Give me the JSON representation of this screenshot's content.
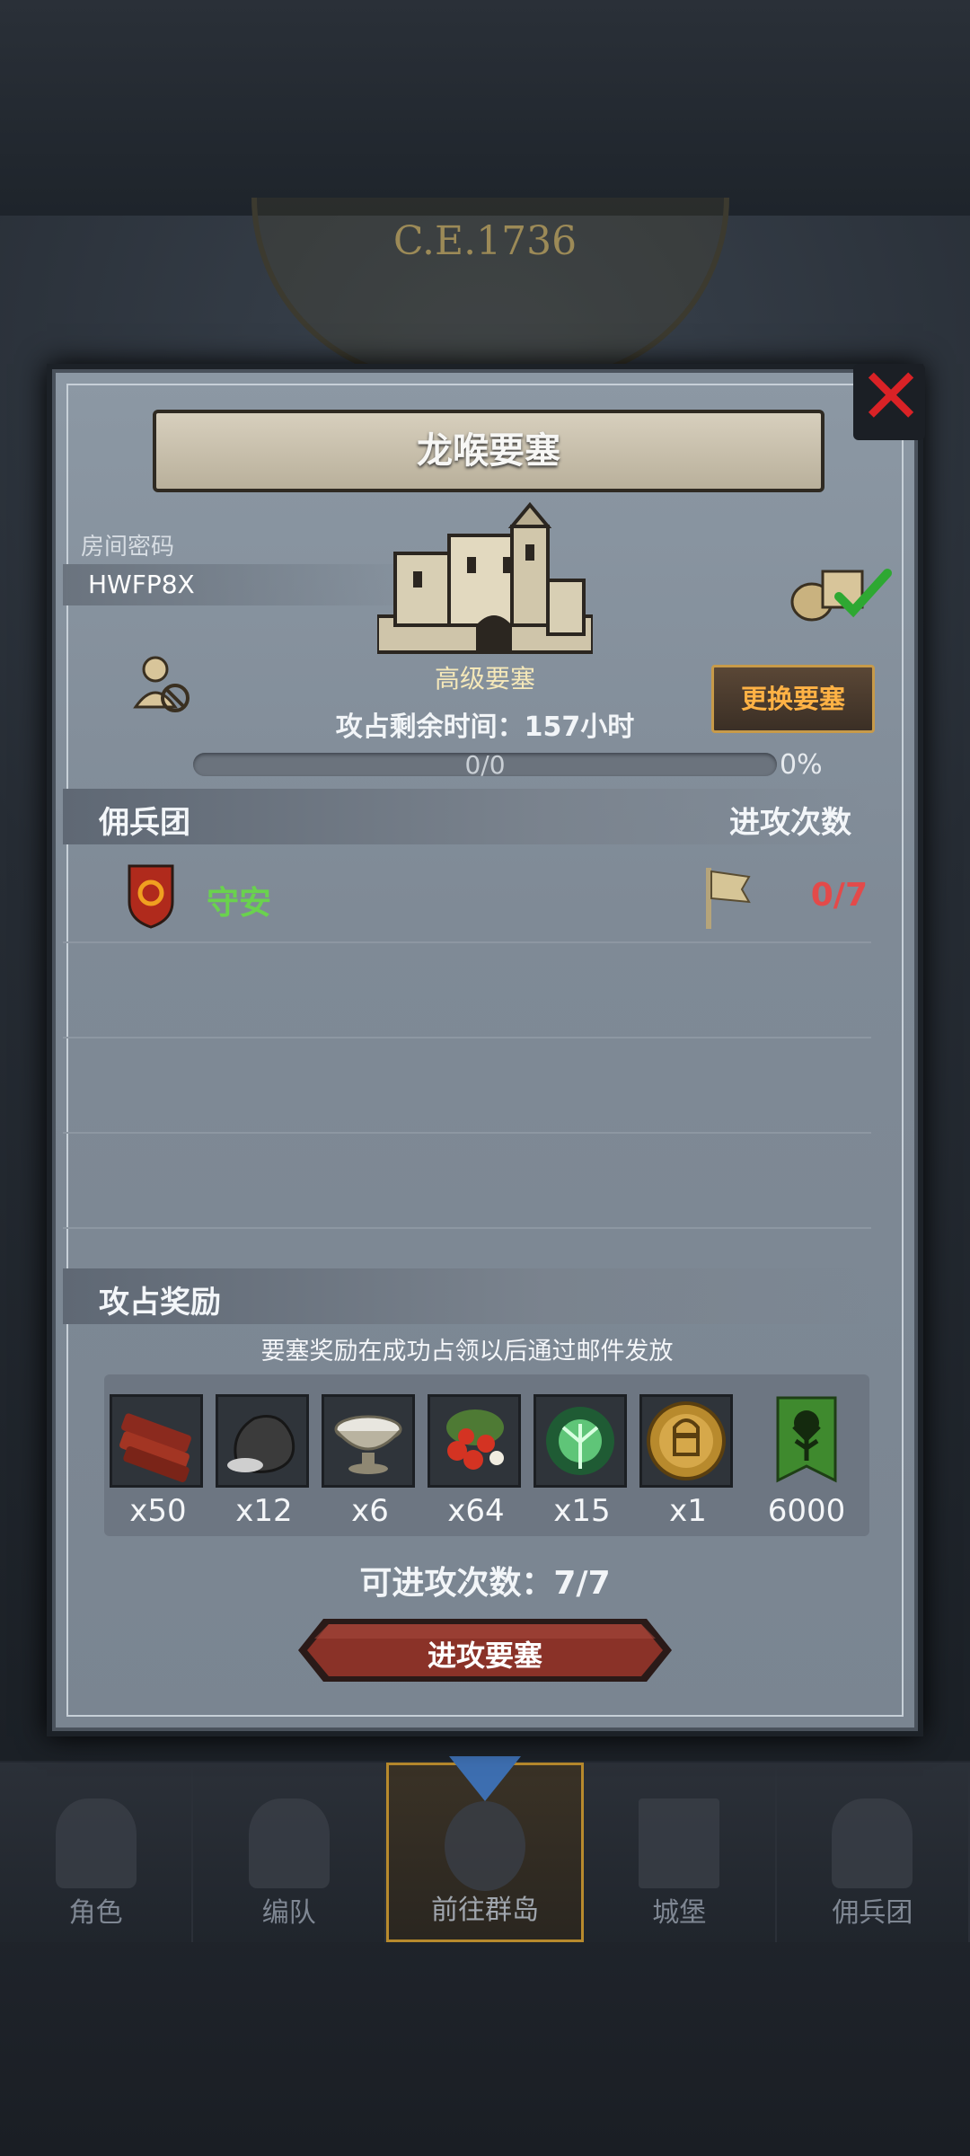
{
  "background": {
    "era": "C.E.1736"
  },
  "dialog": {
    "title": "龙喉要塞",
    "room_code_label": "房间密码",
    "room_code": "HWFP8X",
    "fortress_type": "高级要塞",
    "change_button": "更换要塞",
    "time_label": "攻占剩余时间：157小时",
    "progress": {
      "value": 0,
      "text": "0/0",
      "percent": "0%"
    },
    "mercenary_section": {
      "left": "佣兵团",
      "right": "进攻次数"
    },
    "guild": {
      "name": "守安",
      "attacks": "0/7"
    },
    "reward_section": {
      "title": "攻占奖励"
    },
    "reward_note": "要塞奖励在成功占领以后通过邮件发放",
    "rewards": [
      {
        "icon": "wood-logs-icon",
        "qty": "x50"
      },
      {
        "icon": "ore-rock-icon",
        "qty": "x12"
      },
      {
        "icon": "silver-bowl-icon",
        "qty": "x6"
      },
      {
        "icon": "red-berries-icon",
        "qty": "x64"
      },
      {
        "icon": "green-tree-spirit-icon",
        "qty": "x15"
      },
      {
        "icon": "golden-helmet-medal-icon",
        "qty": "x1"
      },
      {
        "icon": "green-tree-banner-icon",
        "qty": "6000"
      }
    ],
    "attempts": "可进攻次数：7/7",
    "attack_button": "进攻要塞"
  },
  "nav": {
    "items": [
      {
        "label": "角色",
        "icon": "knight-icon"
      },
      {
        "label": "编队",
        "icon": "helmet-icon"
      },
      {
        "label": "前往群岛",
        "icon": "compass-icon"
      },
      {
        "label": "城堡",
        "icon": "castle-icon"
      },
      {
        "label": "佣兵团",
        "icon": "mercenary-icon"
      }
    ],
    "active_index": 2
  },
  "colors": {
    "close": "#d92226",
    "guild_name": "#6ad24e",
    "attack_count": "#e34a4a",
    "change_button_text": "#ffb245",
    "progress_fill": "#d9a741"
  }
}
